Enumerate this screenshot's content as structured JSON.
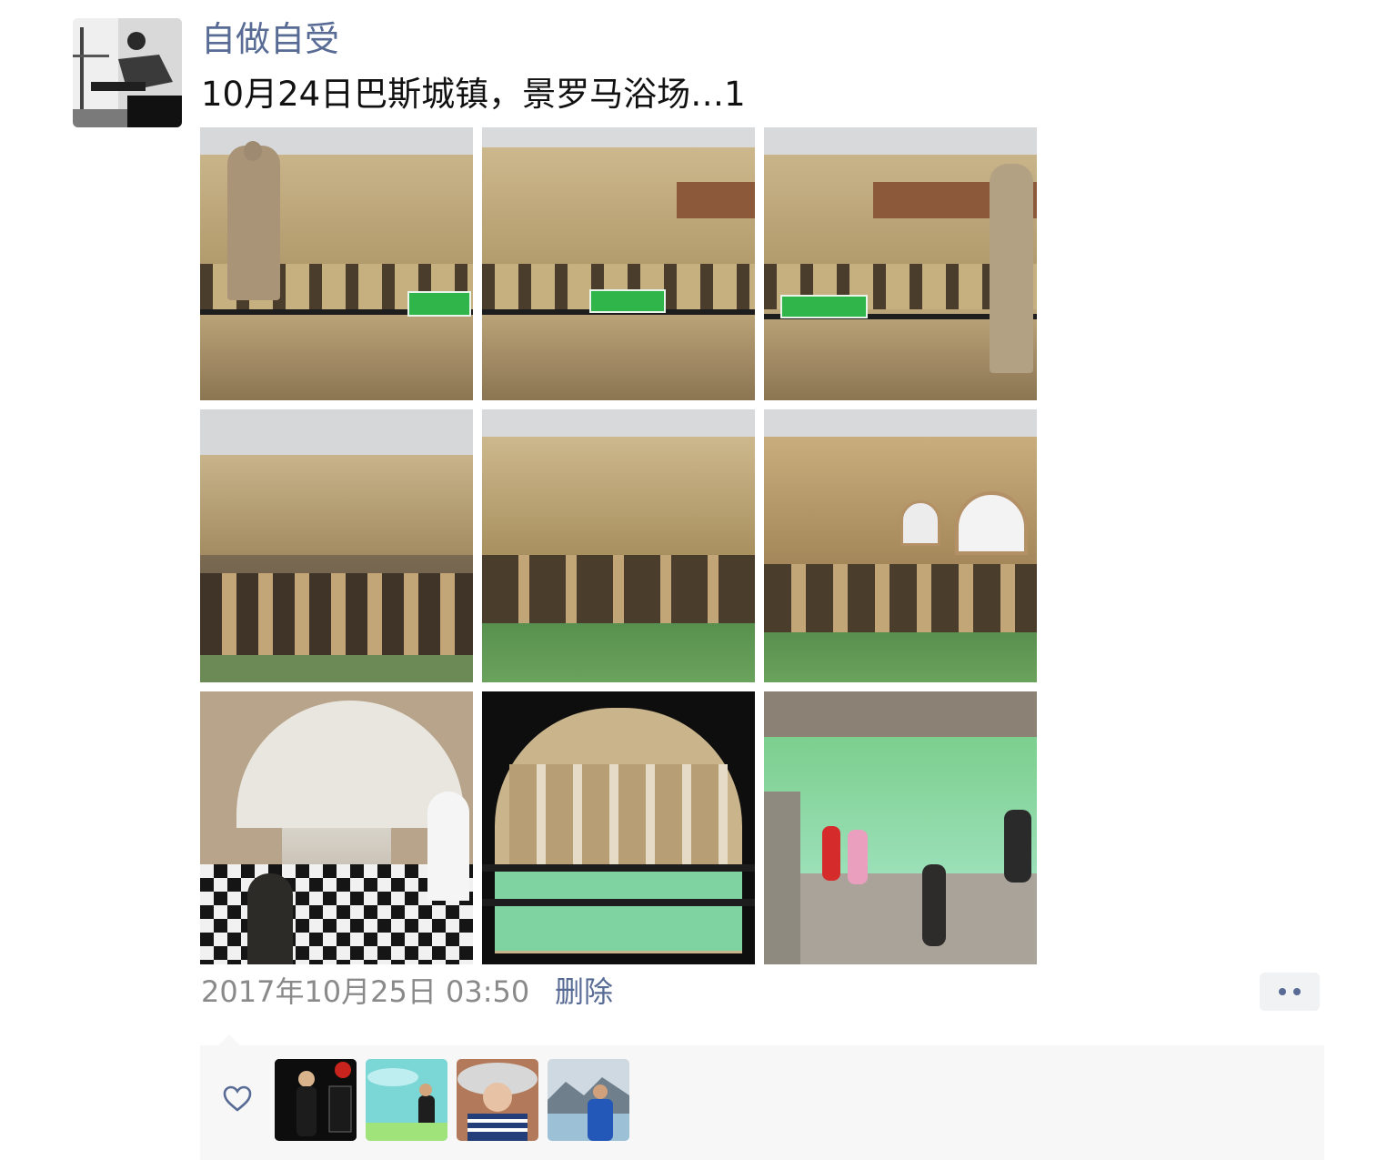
{
  "post": {
    "username": "自做自受",
    "text": "10月24日巴斯城镇，景罗马浴场…1",
    "timestamp": "2017年10月25日 03:50",
    "delete_label": "删除"
  },
  "photos": [
    {
      "name": "photo-roman-baths-terrace-statue-left"
    },
    {
      "name": "photo-roman-baths-terrace-center"
    },
    {
      "name": "photo-roman-baths-terrace-statue-right"
    },
    {
      "name": "photo-roman-baths-colonnade-left"
    },
    {
      "name": "photo-roman-baths-great-bath"
    },
    {
      "name": "photo-roman-baths-arched-windows"
    },
    {
      "name": "photo-checkered-corridor"
    },
    {
      "name": "photo-window-view-of-bath"
    },
    {
      "name": "photo-visitors-at-poolside"
    }
  ],
  "likes": {
    "icon": "heart-icon",
    "avatars": [
      "liker-avatar-1",
      "liker-avatar-2",
      "liker-avatar-3",
      "liker-avatar-4"
    ]
  },
  "colors": {
    "link": "#576b95",
    "text": "#111111",
    "meta": "#8a8a8a",
    "panel": "#f7f7f7",
    "pool_green": "#6fbf73"
  }
}
